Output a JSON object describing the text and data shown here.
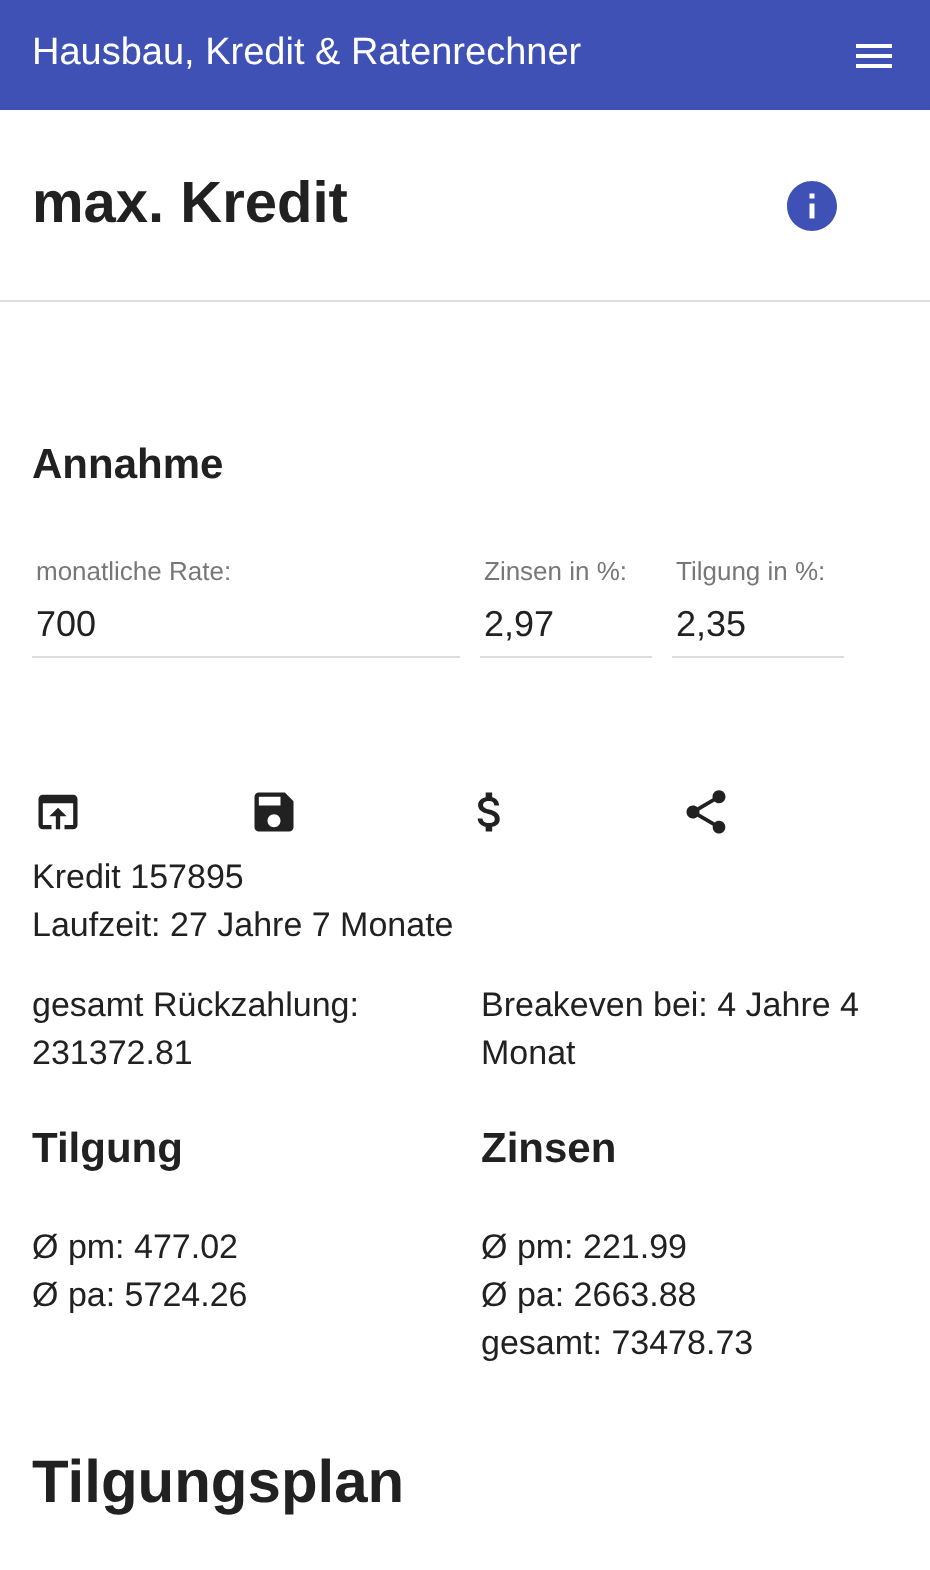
{
  "app_bar": {
    "title": "Hausbau, Kredit & Ratenrechner"
  },
  "page_title": "max. Kredit",
  "section_title": "Annahme",
  "fields": [
    {
      "label": "monatliche Rate:",
      "value": "700"
    },
    {
      "label": "Zinsen in %:",
      "value": "2,97"
    },
    {
      "label": "Tilgung in %:",
      "value": "2,35"
    }
  ],
  "actions": [
    {
      "kind": "open"
    },
    {
      "kind": "save"
    },
    {
      "kind": "dollar"
    },
    {
      "kind": "share"
    }
  ],
  "summary": [
    "Kredit 157895",
    "Laufzeit: 27 Jahre 7 Monate"
  ],
  "totals": [
    "gesamt Rückzahlung: 231372.81",
    "Breakeven bei: 4 Jahre 4 Monat"
  ],
  "groups": [
    {
      "title": "Tilgung",
      "lines": [
        "Ø pm: 477.02",
        "Ø pa: 5724.26"
      ]
    },
    {
      "title": "Zinsen",
      "lines": [
        "Ø pm: 221.99",
        "Ø pa: 2663.88",
        "gesamt: 73478.73"
      ]
    }
  ],
  "plan_title": "Tilgungsplan"
}
